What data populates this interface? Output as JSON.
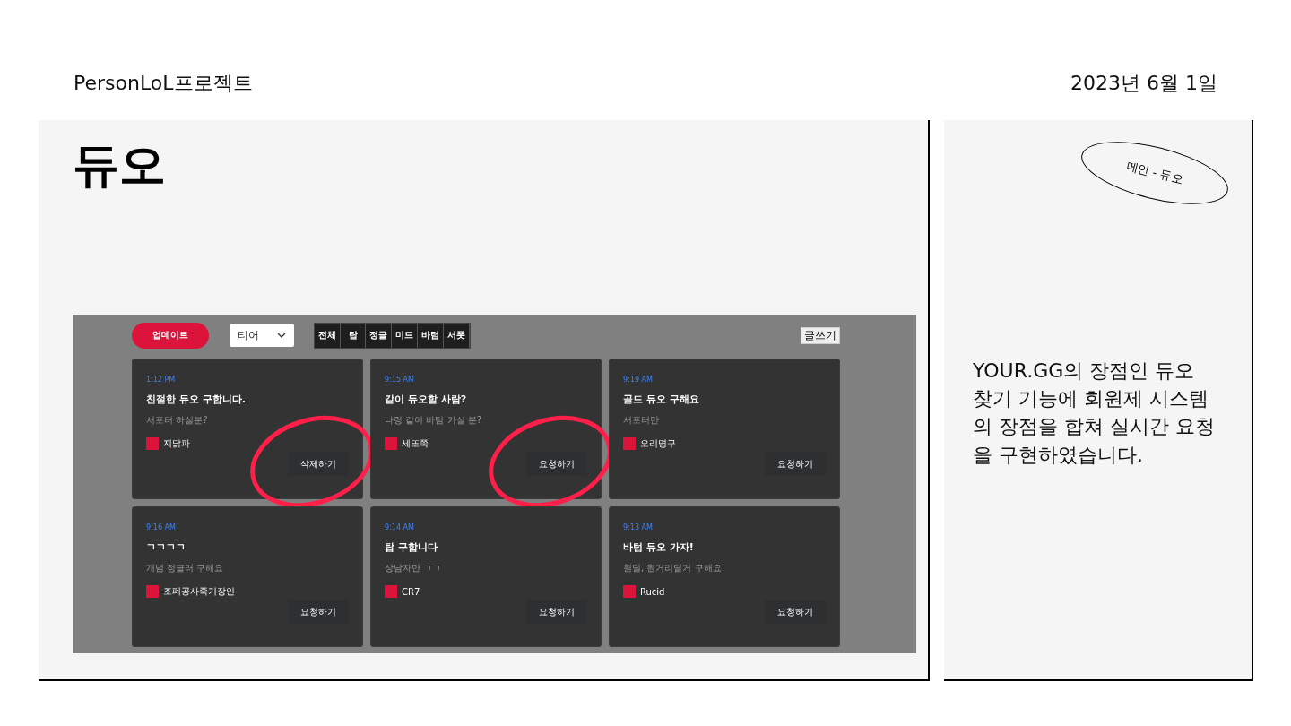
{
  "header": {
    "project": "PersonLoL프로젝트",
    "date": "2023년 6월 1일"
  },
  "page_title": "듀오",
  "app": {
    "update_button": "업데이트",
    "tier_select": "티어",
    "filters": [
      "전체",
      "탑",
      "정글",
      "미드",
      "바텀",
      "서폿"
    ],
    "write_button": "글쓰기",
    "cards": [
      {
        "time": "1:12 PM",
        "title": "친절한 듀오 구합니다.",
        "description": "서포터 하실분?",
        "user": "지닭파",
        "action": "삭제하기",
        "circled": true
      },
      {
        "time": "9:15 AM",
        "title": "같이 듀오할 사람?",
        "description": "나랑 같이 바텀 가실 분?",
        "user": "세또쭉",
        "action": "요청하기",
        "circled": true
      },
      {
        "time": "9:19 AM",
        "title": "골드 듀오 구해요",
        "description": "서포터만",
        "user": "오리명구",
        "action": "요청하기",
        "circled": false
      },
      {
        "time": "9:16 AM",
        "title": "ㄱㄱㄱㄱ",
        "description": "개념 정글러 구해요",
        "user": "조폐공사죽기장인",
        "action": "요청하기",
        "circled": false
      },
      {
        "time": "9:14 AM",
        "title": "탑 구합니다",
        "description": "상남자만 ㄱㄱ",
        "user": "CR7",
        "action": "요청하기",
        "circled": false
      },
      {
        "time": "9:13 AM",
        "title": "바텀 듀오 가자!",
        "description": "원딜, 원거리딜거 구해요!",
        "user": "Rucid",
        "action": "요청하기",
        "circled": false
      }
    ]
  },
  "side": {
    "tag": "메인 - 듀오",
    "text": "YOUR.GG의 장점인 듀오 찾기 기능에 회원제 시스템의 장점을 합쳐 실시간 요청을 구현하였습니다."
  }
}
